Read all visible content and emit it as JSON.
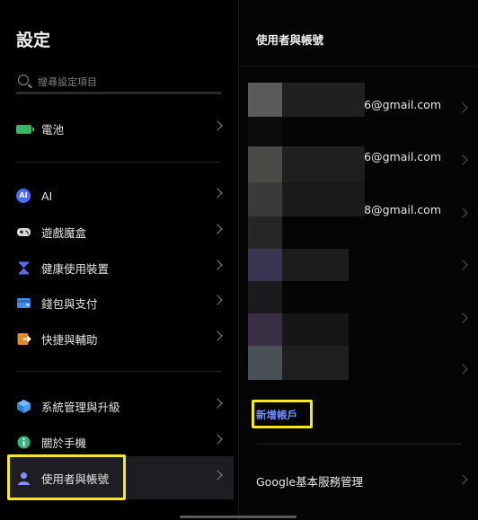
{
  "settings": {
    "title": "設定",
    "search_placeholder": "搜尋設定項目",
    "items": [
      {
        "label": "電池",
        "icon": "battery-icon"
      },
      {
        "label": "AI",
        "icon": "ai-icon"
      },
      {
        "label": "遊戲魔盒",
        "icon": "gamepad-icon"
      },
      {
        "label": "健康使用裝置",
        "icon": "hourglass-icon"
      },
      {
        "label": "錢包與支付",
        "icon": "wallet-icon"
      },
      {
        "label": "快捷與輔助",
        "icon": "shortcut-icon"
      },
      {
        "label": "系統管理與升級",
        "icon": "system-update-icon"
      },
      {
        "label": "關於手機",
        "icon": "info-icon"
      },
      {
        "label": "使用者與帳號",
        "icon": "user-icon"
      }
    ]
  },
  "accounts_panel": {
    "title": "使用者與帳號",
    "accounts": [
      {
        "email": "6@gmail.com"
      },
      {
        "email": "6@gmail.com"
      },
      {
        "email": "8@gmail.com"
      },
      {
        "email": ""
      },
      {
        "email": ""
      },
      {
        "email": ""
      }
    ],
    "add_account_label": "新增帳戶",
    "google_services_label": "Google基本服務管理"
  },
  "colors": {
    "accent_link": "#6e8dff",
    "highlight_box": "#f5ea1d",
    "battery": "#3db565",
    "ai": "#4e6bff"
  }
}
